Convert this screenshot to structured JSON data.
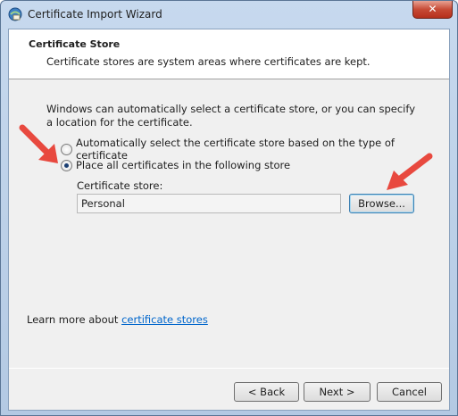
{
  "window": {
    "title": "Certificate Import Wizard",
    "close_glyph": "✕"
  },
  "header": {
    "title": "Certificate Store",
    "subtitle": "Certificate stores are system areas where certificates are kept."
  },
  "body": {
    "description": "Windows can automatically select a certificate store, or you can specify a location for the certificate.",
    "radio_auto_label": "Automatically select the certificate store based on the type of certificate",
    "radio_manual_label": "Place all certificates in the following store",
    "selected_option": "manual",
    "store_label": "Certificate store:",
    "store_value": "Personal",
    "browse_label": "Browse..."
  },
  "footer": {
    "learn_prefix": "Learn more about ",
    "learn_link": "certificate stores",
    "back_label": "< Back",
    "next_label": "Next >",
    "cancel_label": "Cancel"
  },
  "colors": {
    "annotation_arrow": "#e8493f",
    "link": "#0066cc"
  }
}
